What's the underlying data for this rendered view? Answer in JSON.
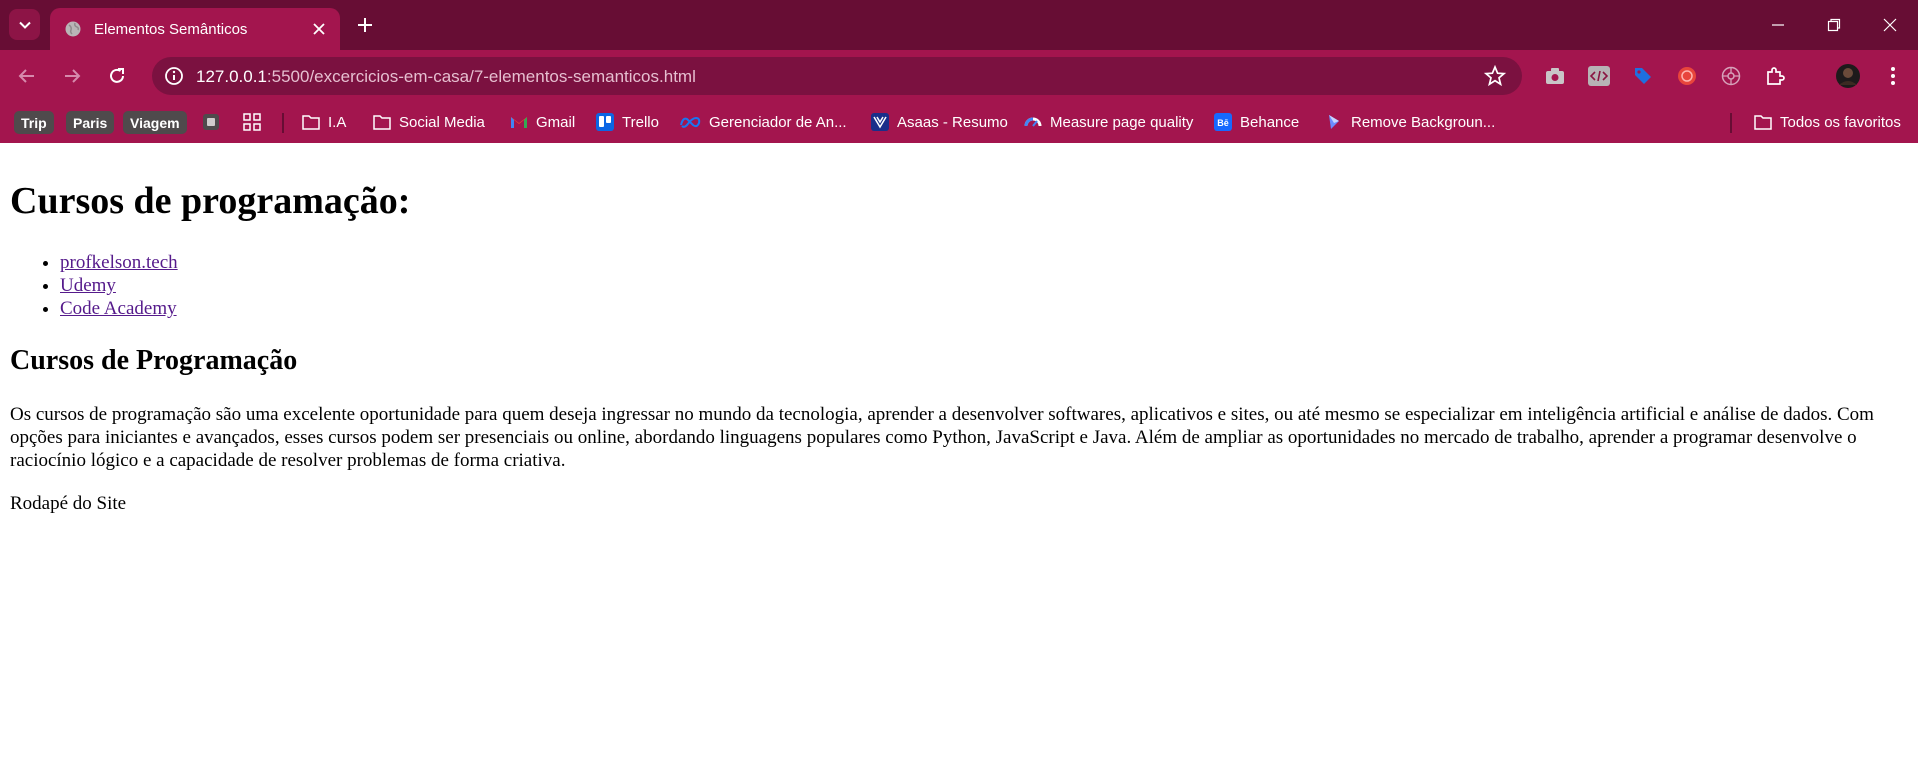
{
  "browser": {
    "tab_title": "Elementos Semânticos",
    "url_host": "127.0.0.1",
    "url_rest": ":5500/excercicios-em-casa/7-elementos-semanticos.html",
    "colors": {
      "frame": "#670d34",
      "toolbar": "#a3154e",
      "omnibox": "#7b1140"
    }
  },
  "bookmarks": {
    "chips": [
      "Trip",
      "Paris",
      "Viagem"
    ],
    "items": [
      {
        "label": "I.A",
        "icon": "folder-icon"
      },
      {
        "label": "Social Media",
        "icon": "folder-icon"
      },
      {
        "label": "Gmail",
        "icon": "gmail-icon"
      },
      {
        "label": "Trello",
        "icon": "trello-icon"
      },
      {
        "label": "Gerenciador de An...",
        "icon": "meta-icon"
      },
      {
        "label": "Asaas - Resumo",
        "icon": "asaas-icon"
      },
      {
        "label": "Measure page quality",
        "icon": "pagespeed-icon"
      },
      {
        "label": "Behance",
        "icon": "behance-icon"
      },
      {
        "label": "Remove Backgroun...",
        "icon": "removebg-icon"
      }
    ],
    "all_bookmarks": "Todos os favoritos"
  },
  "page": {
    "heading": "Cursos de programação:",
    "links": [
      "profkelson.tech",
      "Udemy",
      "Code Academy"
    ],
    "section_title": "Cursos de Programação",
    "article_text": "Os cursos de programação são uma excelente oportunidade para quem deseja ingressar no mundo da tecnologia, aprender a desenvolver softwares, aplicativos e sites, ou até mesmo se especializar em inteligência artificial e análise de dados. Com opções para iniciantes e avançados, esses cursos podem ser presenciais ou online, abordando linguagens populares como Python, JavaScript e Java. Além de ampliar as oportunidades no mercado de trabalho, aprender a programar desenvolve o raciocínio lógico e a capacidade de resolver problemas de forma criativa.",
    "footer": "Rodapé do Site"
  }
}
